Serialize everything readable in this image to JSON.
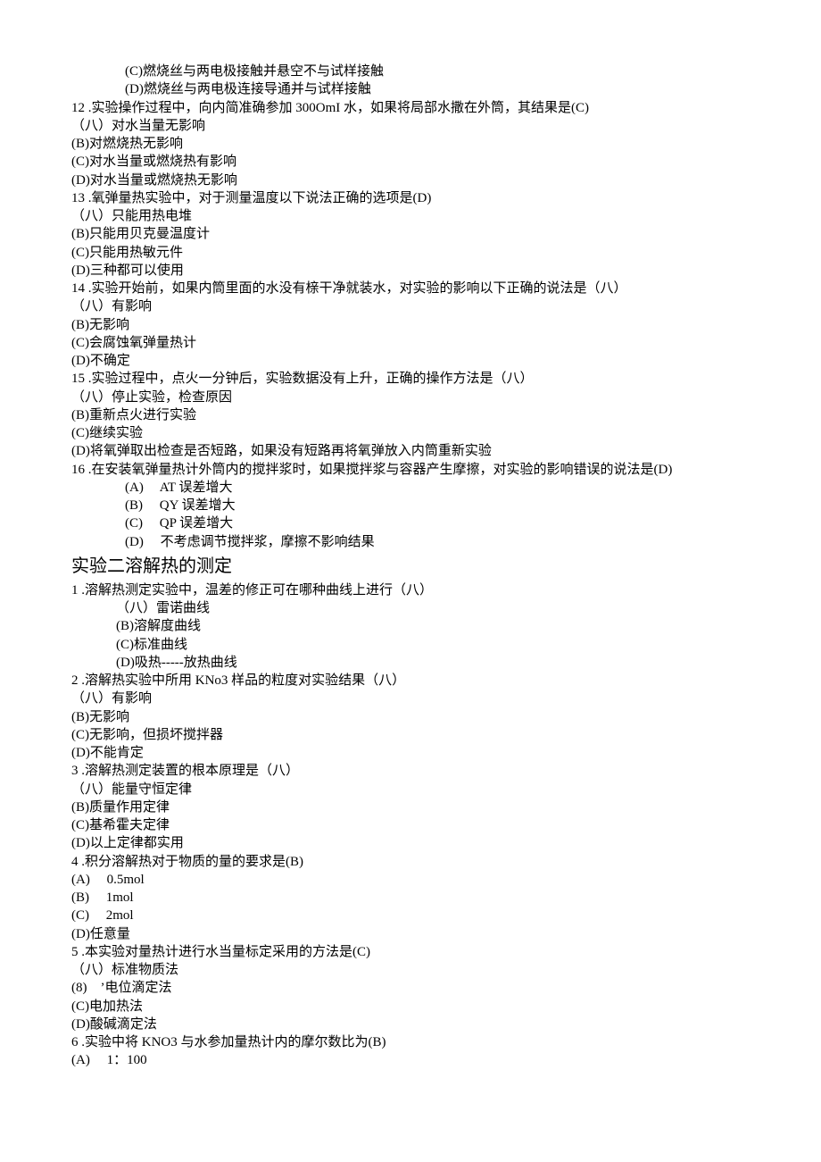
{
  "lines": [
    {
      "cls": "indent1",
      "text": "(C)燃烧丝与两电极接触并悬空不与试样接触"
    },
    {
      "cls": "indent1",
      "text": "(D)燃烧丝与两电极连接导通并与试样接触"
    },
    {
      "cls": "",
      "text": "12 .实验操作过程中，向内简准确参加 300OmI 水，如果将局部水撒在外筒，其结果是(C)"
    },
    {
      "cls": "",
      "text": "（八）对水当量无影响"
    },
    {
      "cls": "",
      "text": "(B)对燃烧热无影响"
    },
    {
      "cls": "",
      "text": "(C)对水当量或燃烧热有影响"
    },
    {
      "cls": "",
      "text": "(D)对水当量或燃烧热无影响"
    },
    {
      "cls": "",
      "text": "13 .氧弹量热实验中，对于测量温度以下说法正确的选项是(D)"
    },
    {
      "cls": "",
      "text": "（八）只能用热电堆"
    },
    {
      "cls": "",
      "text": "(B)只能用贝克曼温度计"
    },
    {
      "cls": "",
      "text": "(C)只能用热敏元件"
    },
    {
      "cls": "",
      "text": "(D)三种都可以使用"
    },
    {
      "cls": "",
      "text": "14 .实验开始前，如果内筒里面的水没有榇干净就装水，对实验的影响以下正确的说法是（八）"
    },
    {
      "cls": "",
      "text": "（八）有影响"
    },
    {
      "cls": "",
      "text": "(B)无影响"
    },
    {
      "cls": "",
      "text": "(C)会腐蚀氧弹量热计"
    },
    {
      "cls": "",
      "text": "(D)不确定"
    },
    {
      "cls": "",
      "text": "15 .实验过程中，点火一分钟后，实验数据没有上升，正确的操作方法是（八）"
    },
    {
      "cls": "",
      "text": "（八）停止实验，检查原因"
    },
    {
      "cls": "",
      "text": "(B)重新点火进行实验"
    },
    {
      "cls": "",
      "text": "(C)继续实验"
    },
    {
      "cls": "",
      "text": "(D)将氧弹取出检查是否短路，如果没有短路再将氧弹放入内筒重新实验"
    },
    {
      "cls": "",
      "text": "16 .在安装氧弹量热计外筒内的搅拌浆时，如果搅拌浆与容器产生摩擦，对实验的影响错误的说法是(D)"
    },
    {
      "cls": "indent1",
      "text": "(A)     AT 误差增大"
    },
    {
      "cls": "indent1",
      "text": "(B)     QY 误差增大"
    },
    {
      "cls": "indent1",
      "text": "(C)     QP 误差增大"
    },
    {
      "cls": "indent1",
      "text": "(D)     不考虑调节搅拌浆，摩擦不影响结果"
    },
    {
      "cls": "title",
      "text": "实验二溶解热的测定"
    },
    {
      "cls": "",
      "text": "1 .溶解热测定实验中，温差的修正可在哪种曲线上进行（八）"
    },
    {
      "cls": "indent2",
      "text": "（八）雷诺曲线"
    },
    {
      "cls": "indent2",
      "text": "(B)溶解度曲线"
    },
    {
      "cls": "indent2",
      "text": "(C)标准曲线"
    },
    {
      "cls": "indent2",
      "text": "(D)吸热-----放热曲线"
    },
    {
      "cls": "",
      "text": "2 .溶解热实验中所用 KNo3 样品的粒度对实验结果（八）"
    },
    {
      "cls": "",
      "text": "（八）有影响"
    },
    {
      "cls": "",
      "text": "(B)无影响"
    },
    {
      "cls": "",
      "text": "(C)无影响，但损坏搅拌器"
    },
    {
      "cls": "",
      "text": "(D)不能肯定"
    },
    {
      "cls": "",
      "text": "3 .溶解热测定装置的根本原理是（八）"
    },
    {
      "cls": "",
      "text": "（八）能量守恒定律"
    },
    {
      "cls": "",
      "text": "(B)质量作用定律"
    },
    {
      "cls": "",
      "text": "(C)基希霍夫定律"
    },
    {
      "cls": "",
      "text": "(D)以上定律都实用"
    },
    {
      "cls": "",
      "text": "4 .积分溶解热对于物质的量的要求是(B)"
    },
    {
      "cls": "",
      "text": "(A)     0.5mol"
    },
    {
      "cls": "",
      "text": "(B)     1mol"
    },
    {
      "cls": "",
      "text": "(C)     2mol"
    },
    {
      "cls": "",
      "text": "(D)任意量"
    },
    {
      "cls": "",
      "text": "5 .本实验对量热计进行水当量标定采用的方法是(C)"
    },
    {
      "cls": "",
      "text": "（八）标准物质法"
    },
    {
      "cls": "",
      "text": "(8)    ’电位滴定法"
    },
    {
      "cls": "",
      "text": "(C)电加热法"
    },
    {
      "cls": "",
      "text": "(D)酸碱滴定法"
    },
    {
      "cls": "",
      "text": "6 .实验中将 KNO3 与水参加量热计内的摩尔数比为(B)"
    },
    {
      "cls": "",
      "text": "(A)     1：100"
    }
  ]
}
